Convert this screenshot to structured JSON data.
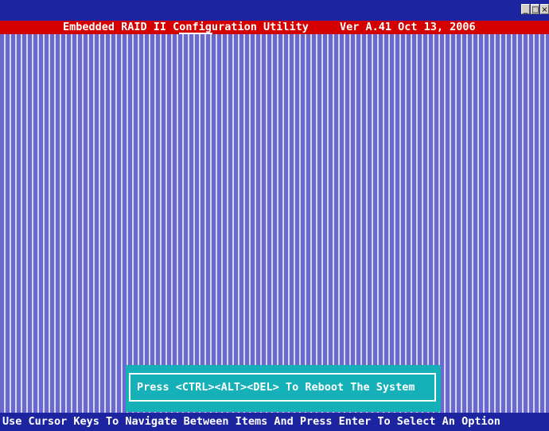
{
  "window": {
    "buttons": [
      {
        "icon": "minimize-icon",
        "glyph": "_"
      },
      {
        "icon": "restore-icon",
        "glyph": "□"
      },
      {
        "icon": "close-icon",
        "glyph": "×"
      }
    ]
  },
  "header": {
    "title": "Embedded RAID II Configuration Utility",
    "version": "Ver A.41 Oct 13, 2006"
  },
  "dialog": {
    "message": "Press <CTRL><ALT><DEL> To Reboot The System"
  },
  "status_bar": {
    "text": "Use Cursor Keys To Navigate Between Items And Press Enter To Select An Option"
  },
  "colors": {
    "title_bar": "#d40000",
    "background": "#6f6fd2",
    "status_bar": "#1c24a0",
    "dialog": "#15b0b8",
    "text": "#ffffff"
  }
}
